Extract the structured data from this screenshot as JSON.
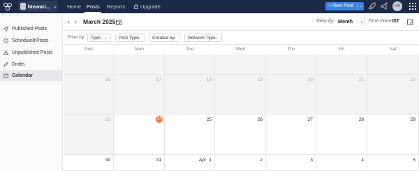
{
  "topbar": {
    "brand_name": "htewari...",
    "nav": [
      "Home",
      "Posts",
      "Reports"
    ],
    "active_nav": "Posts",
    "upgrade_label": "Upgrade",
    "new_post_label": "+ New Post",
    "user_initials": "HA",
    "icons": [
      "logo-icon",
      "lock-icon",
      "rocket-icon",
      "megaphone-icon",
      "apps-grid-icon"
    ]
  },
  "sidebar": {
    "items": [
      {
        "label": "Published Posts",
        "icon": "paper-plane-icon"
      },
      {
        "label": "Scheduled Posts",
        "icon": "clock-icon"
      },
      {
        "label": "Unpublished Posts",
        "icon": "warning-icon"
      },
      {
        "label": "Drafts",
        "icon": "pencil-icon"
      },
      {
        "label": "Calendar",
        "icon": "calendar-icon"
      }
    ],
    "active": "Calendar"
  },
  "header": {
    "month_label": "March 2025",
    "view_by_label": "View by:",
    "view_by_value": "Month",
    "timezone_label": "Time Zone :",
    "timezone_value": "IST"
  },
  "filters": {
    "label": "Filter by:",
    "buttons": [
      "Type",
      "Post Type",
      "Created by",
      "Network Type"
    ]
  },
  "calendar": {
    "days_of_week": [
      "Sun",
      "Mon",
      "Tue",
      "Wed",
      "Thu",
      "Fri",
      "Sat"
    ],
    "weeks": [
      [
        {
          "d": "",
          "past": true
        },
        {
          "d": "",
          "past": true
        },
        {
          "d": "",
          "past": true
        },
        {
          "d": "",
          "past": true
        },
        {
          "d": "",
          "past": true
        },
        {
          "d": "",
          "past": true
        },
        {
          "d": "",
          "past": true
        }
      ],
      [
        {
          "d": "16",
          "past": true
        },
        {
          "d": "17",
          "past": true
        },
        {
          "d": "18",
          "past": true
        },
        {
          "d": "19",
          "past": true
        },
        {
          "d": "20",
          "past": true
        },
        {
          "d": "21",
          "past": true
        },
        {
          "d": "22",
          "past": true
        }
      ],
      [
        {
          "d": "23",
          "past": true
        },
        {
          "d": "24",
          "past": false,
          "today": true
        },
        {
          "d": "25",
          "past": false
        },
        {
          "d": "26",
          "past": false
        },
        {
          "d": "27",
          "past": false
        },
        {
          "d": "28",
          "past": false
        },
        {
          "d": "29",
          "past": false
        }
      ],
      [
        {
          "d": "30",
          "past": false
        },
        {
          "d": "31",
          "past": false
        },
        {
          "d": "1",
          "past": false,
          "prefix": "Apr"
        },
        {
          "d": "2",
          "past": false
        },
        {
          "d": "3",
          "past": false
        },
        {
          "d": "4",
          "past": false
        },
        {
          "d": "5",
          "past": false
        }
      ]
    ],
    "accent": "#f07a3a"
  }
}
